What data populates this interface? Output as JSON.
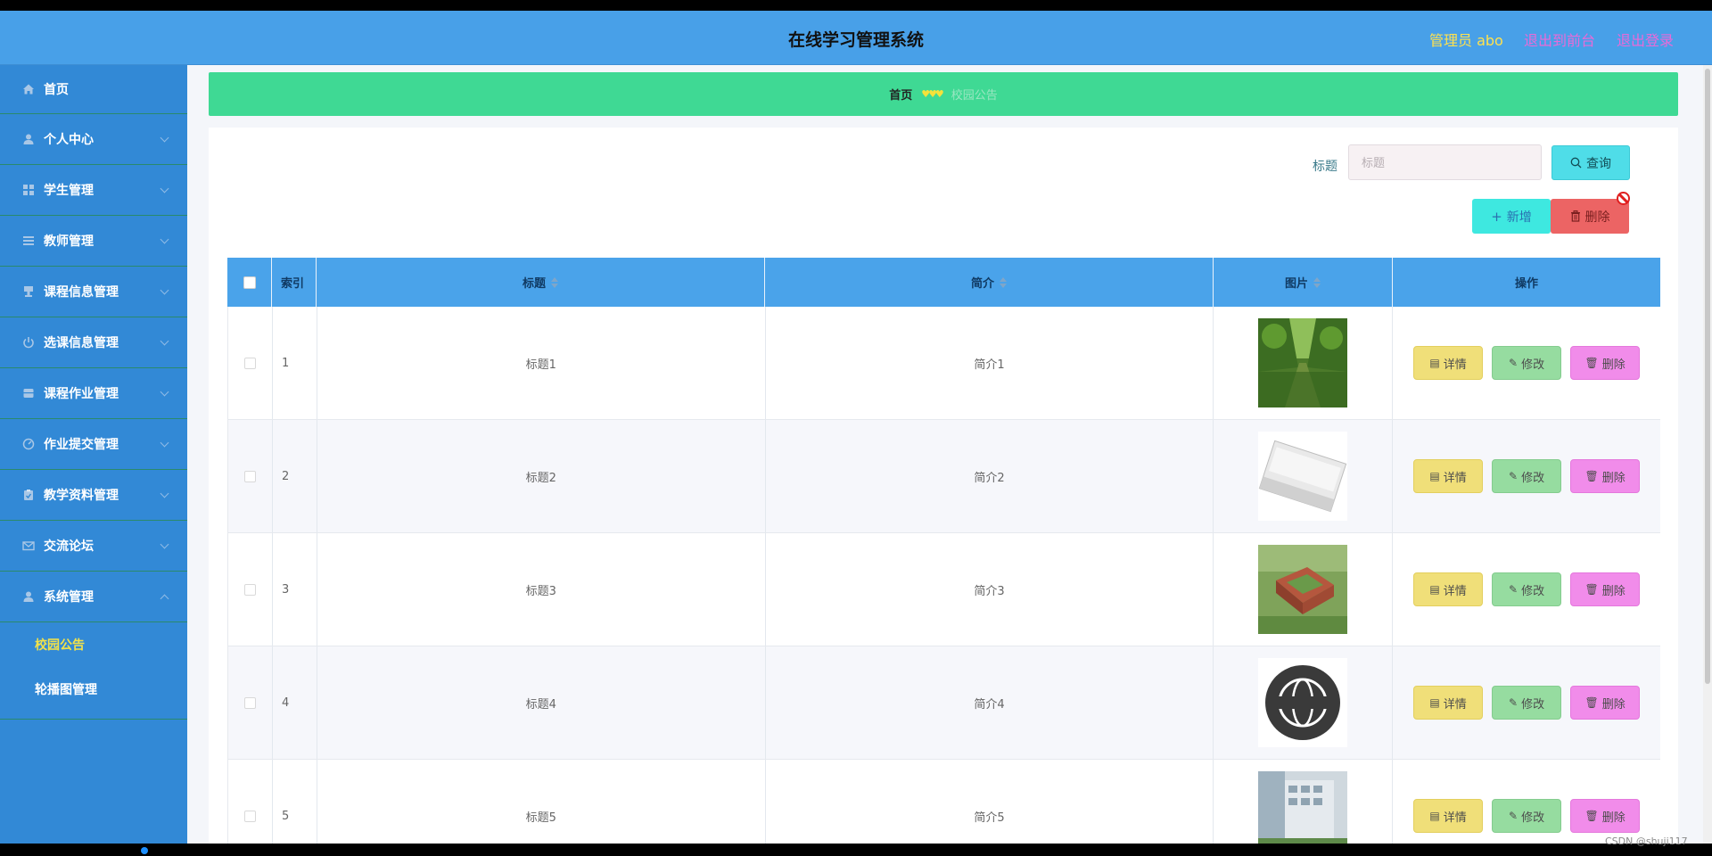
{
  "header": {
    "title": "在线学习管理系统",
    "admin": "管理员 abo",
    "back_to_front": "退出到前台",
    "logout": "退出登录"
  },
  "sidebar": {
    "items": [
      {
        "label": "首页",
        "icon": "home-icon",
        "expandable": false
      },
      {
        "label": "个人中心",
        "icon": "user-icon",
        "expandable": true
      },
      {
        "label": "学生管理",
        "icon": "grid-icon",
        "expandable": true
      },
      {
        "label": "教师管理",
        "icon": "list-icon",
        "expandable": true
      },
      {
        "label": "课程信息管理",
        "icon": "cup-icon",
        "expandable": true
      },
      {
        "label": "选课信息管理",
        "icon": "power-icon",
        "expandable": true
      },
      {
        "label": "课程作业管理",
        "icon": "box-icon",
        "expandable": true
      },
      {
        "label": "作业提交管理",
        "icon": "gauge-icon",
        "expandable": true
      },
      {
        "label": "教学资料管理",
        "icon": "clipboard-icon",
        "expandable": true
      },
      {
        "label": "交流论坛",
        "icon": "mail-icon",
        "expandable": true
      },
      {
        "label": "系统管理",
        "icon": "user-icon",
        "expandable": true,
        "expanded": true
      }
    ],
    "submenu": [
      {
        "label": "校园公告",
        "active": true
      },
      {
        "label": "轮播图管理",
        "active": false
      }
    ]
  },
  "breadcrumb": {
    "home": "首页",
    "separator": "♥♥♥",
    "current": "校园公告"
  },
  "search": {
    "label": "标题",
    "placeholder": "标题",
    "query_button": "查询"
  },
  "actions": {
    "add_button": "新增",
    "delete_button": "删除"
  },
  "table": {
    "headers": {
      "index": "索引",
      "title": "标题",
      "desc": "简介",
      "image": "图片",
      "ops": "操作"
    },
    "op_labels": {
      "detail": "详情",
      "edit": "修改",
      "delete": "删除"
    },
    "rows": [
      {
        "index": "1",
        "title": "标题1",
        "desc": "简介1",
        "image": "tree-lined-path"
      },
      {
        "index": "2",
        "title": "标题2",
        "desc": "简介2",
        "image": "news-newspaper"
      },
      {
        "index": "3",
        "title": "标题3",
        "desc": "简介3",
        "image": "campus-aerial"
      },
      {
        "index": "4",
        "title": "标题4",
        "desc": "简介4",
        "image": "news-globe-badge"
      },
      {
        "index": "5",
        "title": "标题5",
        "desc": "简介5",
        "image": "modern-building"
      }
    ]
  },
  "watermark": "CSDN @shuji117"
}
